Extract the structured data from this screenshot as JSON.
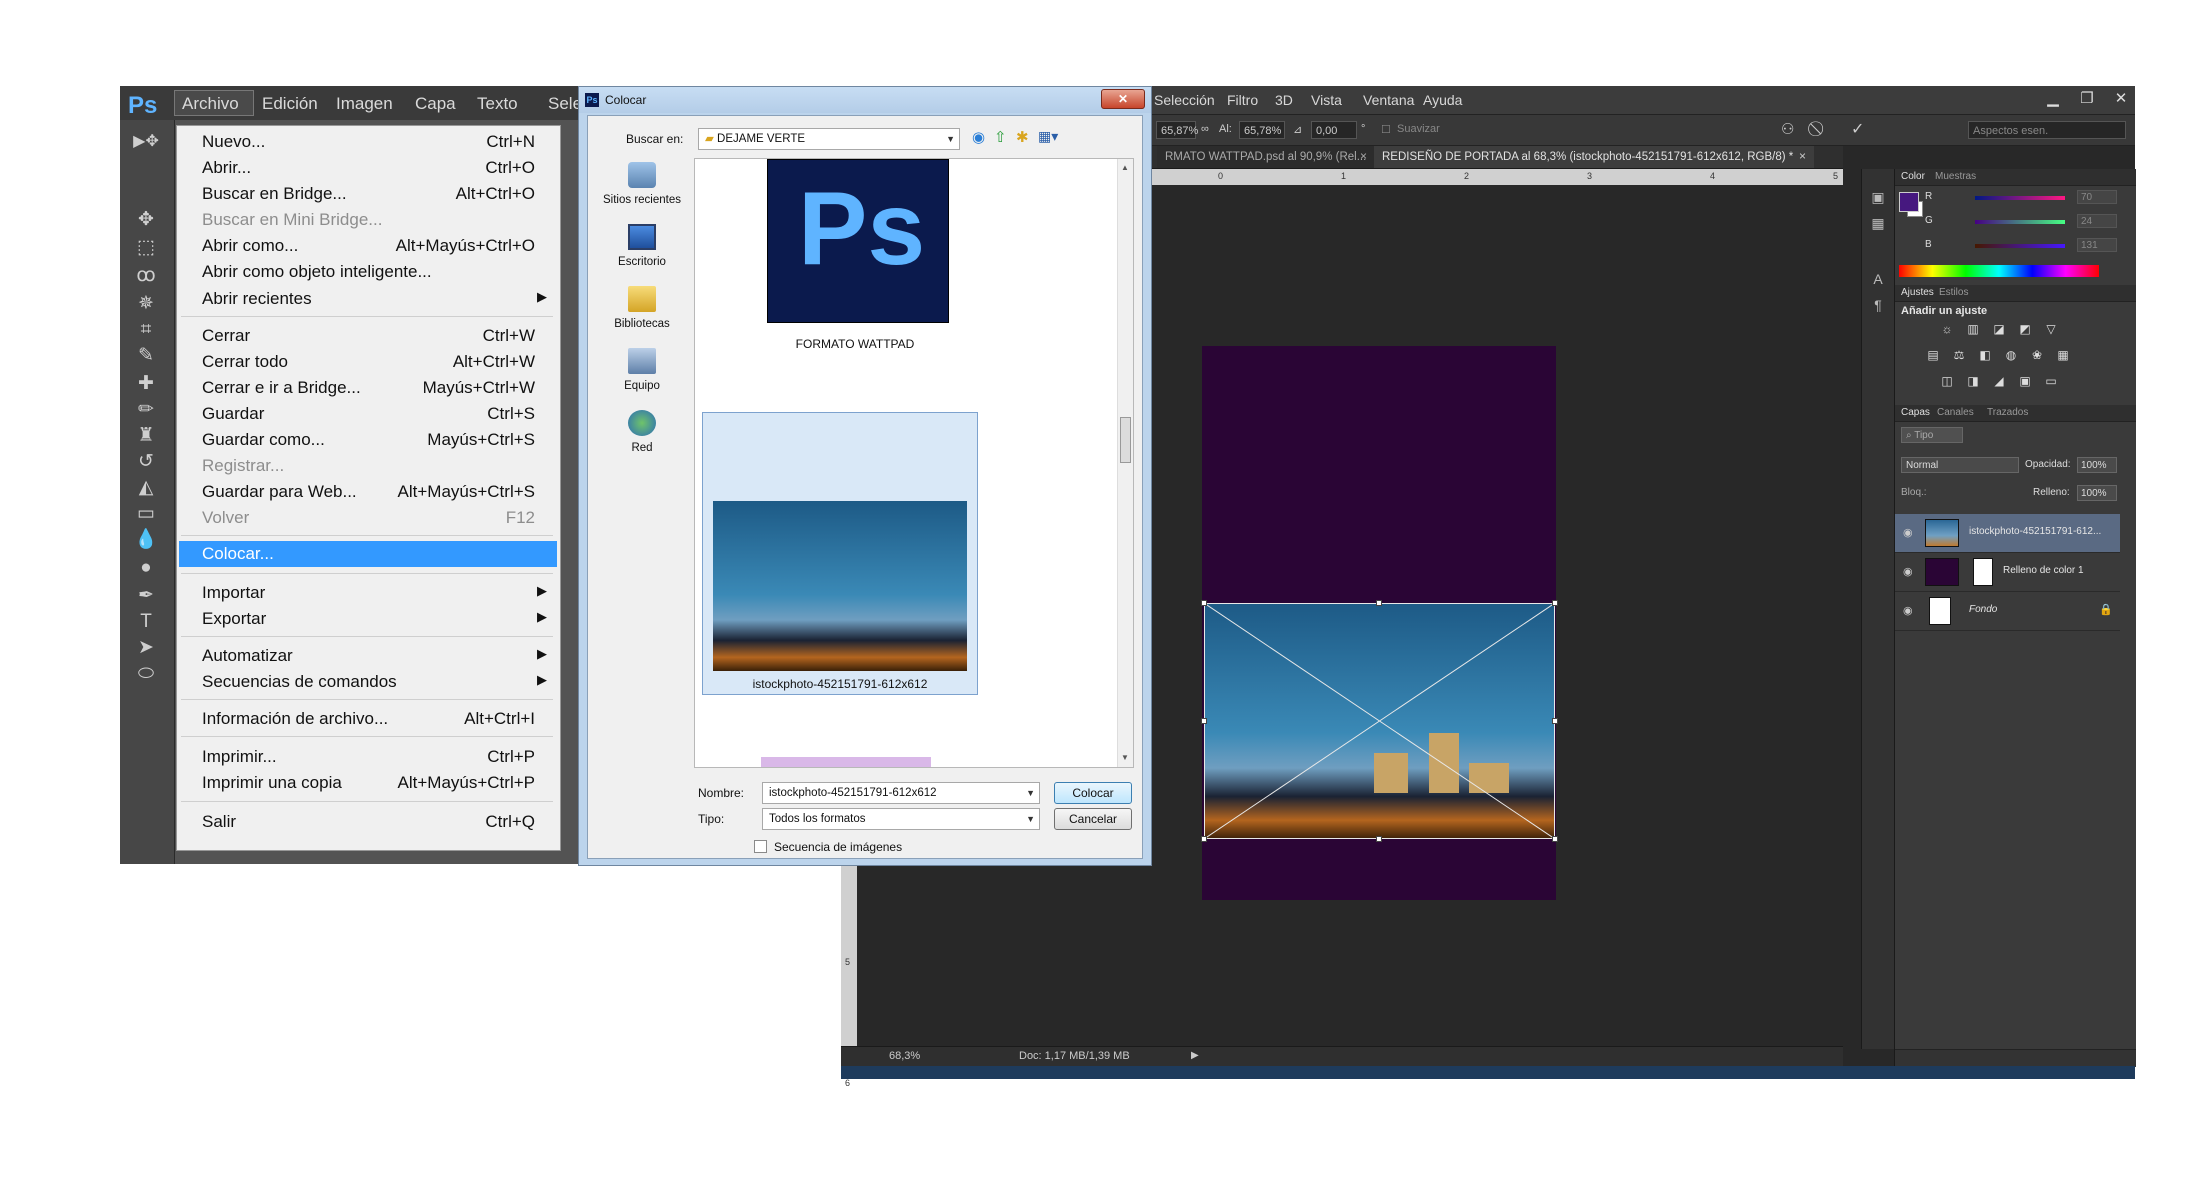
{
  "back_window": {
    "menus": [
      "Selección",
      "Filtro",
      "3D",
      "Vista",
      "Ventana",
      "Ayuda"
    ],
    "options": {
      "w_value": "65,87%",
      "h_label": "Al:",
      "h_value": "65,78%",
      "angle_value": "0,00",
      "angle_unit": "°",
      "smooth_label": "Suavizar",
      "workspace_placeholder": "Aspectos esen."
    },
    "tabs": [
      "RMATO WATTPAD.psd al 90,9% (Rel...",
      "REDISEÑO DE PORTADA al 68,3% (istockphoto-452151791-612x612, RGB/8) *"
    ],
    "tab_close": "×",
    "ruler_h": [
      "0",
      "1",
      "2",
      "3",
      "4",
      "5"
    ],
    "ruler_v": [
      "5",
      "6"
    ],
    "status": {
      "zoom": "68,3%",
      "doc": "Doc: 1,17 MB/1,39 MB"
    }
  },
  "panels": {
    "color_tabs": [
      "Color",
      "Muestras"
    ],
    "color_values": [
      {
        "label": "R",
        "value": "70"
      },
      {
        "label": "G",
        "value": "24"
      },
      {
        "label": "B",
        "value": "131"
      }
    ],
    "fg_color": "#46187f",
    "adjust_tabs": [
      "Ajustes",
      "Estilos"
    ],
    "adjust_heading": "Añadir un ajuste",
    "layers_tabs": [
      "Capas",
      "Canales",
      "Trazados"
    ],
    "layer_kind": "Tipo",
    "blend_mode": "Normal",
    "opacity_label": "Opacidad:",
    "opacity_value": "100%",
    "lock_label": "Bloq.:",
    "fill_label": "Relleno:",
    "fill_value": "100%",
    "layers": [
      {
        "name": "istockphoto-452151791-612..."
      },
      {
        "name": "Relleno de color 1"
      },
      {
        "name": "Fondo"
      }
    ]
  },
  "front_window": {
    "logo": "Ps",
    "menus": [
      "Archivo",
      "Edición",
      "Imagen",
      "Capa",
      "Texto",
      "Sele"
    ]
  },
  "archivo_menu": [
    {
      "label": "Nuevo...",
      "shortcut": "Ctrl+N"
    },
    {
      "label": "Abrir...",
      "shortcut": "Ctrl+O"
    },
    {
      "label": "Buscar en Bridge...",
      "shortcut": "Alt+Ctrl+O"
    },
    {
      "label": "Buscar en Mini Bridge...",
      "shortcut": ""
    },
    {
      "label": "Abrir como...",
      "shortcut": "Alt+Mayús+Ctrl+O"
    },
    {
      "label": "Abrir como objeto inteligente...",
      "shortcut": ""
    },
    {
      "label": "Abrir recientes",
      "shortcut": ""
    },
    {
      "label": "Cerrar",
      "shortcut": "Ctrl+W"
    },
    {
      "label": "Cerrar todo",
      "shortcut": "Alt+Ctrl+W"
    },
    {
      "label": "Cerrar e ir a Bridge...",
      "shortcut": "Mayús+Ctrl+W"
    },
    {
      "label": "Guardar",
      "shortcut": "Ctrl+S"
    },
    {
      "label": "Guardar como...",
      "shortcut": "Mayús+Ctrl+S"
    },
    {
      "label": "Registrar...",
      "shortcut": ""
    },
    {
      "label": "Guardar para Web...",
      "shortcut": "Alt+Mayús+Ctrl+S"
    },
    {
      "label": "Volver",
      "shortcut": "F12"
    },
    {
      "label": "Colocar...",
      "shortcut": ""
    },
    {
      "label": "Importar",
      "shortcut": ""
    },
    {
      "label": "Exportar",
      "shortcut": ""
    },
    {
      "label": "Automatizar",
      "shortcut": ""
    },
    {
      "label": "Secuencias de comandos",
      "shortcut": ""
    },
    {
      "label": "Información de archivo...",
      "shortcut": "Alt+Ctrl+I"
    },
    {
      "label": "Imprimir...",
      "shortcut": "Ctrl+P"
    },
    {
      "label": "Imprimir una copia",
      "shortcut": "Alt+Mayús+Ctrl+P"
    },
    {
      "label": "Salir",
      "shortcut": "Ctrl+Q"
    }
  ],
  "dialog": {
    "title": "Colocar",
    "close": "✕",
    "lookin_label": "Buscar en:",
    "lookin_value": "DEJAME VERTE",
    "places": [
      "Sitios recientes",
      "Escritorio",
      "Bibliotecas",
      "Equipo",
      "Red"
    ],
    "files": [
      {
        "name": "FORMATO WATTPAD",
        "thumb_text": "Ps"
      },
      {
        "name": "istockphoto-452151791-612x612"
      }
    ],
    "name_label": "Nombre:",
    "name_value": "istockphoto-452151791-612x612",
    "type_label": "Tipo:",
    "type_value": "Todos los formatos",
    "sequence_label": "Secuencia de imágenes",
    "place_button": "Colocar",
    "cancel_button": "Cancelar"
  }
}
